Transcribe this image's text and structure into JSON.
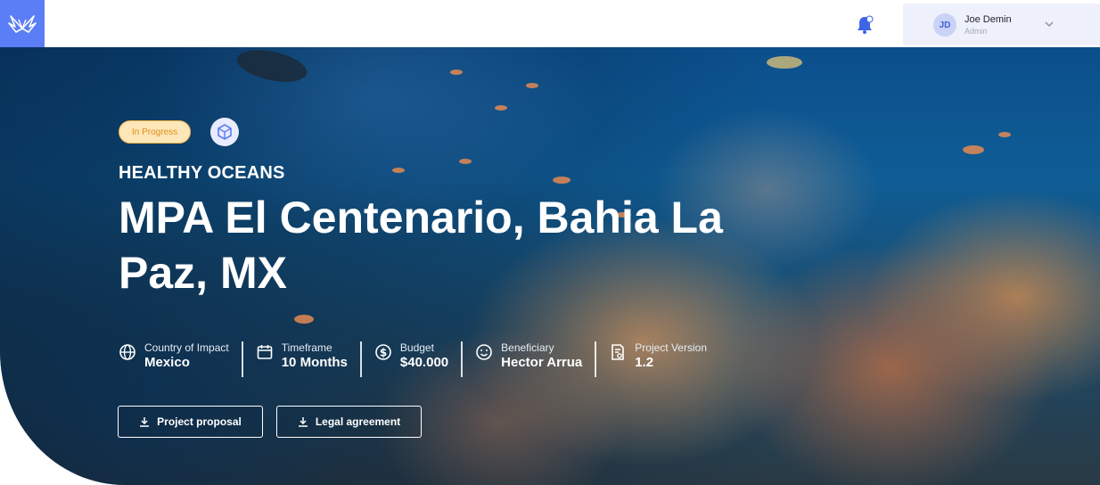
{
  "header": {
    "notification_count": "0",
    "user": {
      "initials": "JD",
      "name": "Joe Demin",
      "role": "Admin"
    }
  },
  "project": {
    "status": "In Progress",
    "category": "HEALTHY OCEANS",
    "title": "MPA El Centenario, Bahia La Paz, MX",
    "facts": [
      {
        "icon": "globe-icon",
        "label": "Country of Impact",
        "value": "Mexico"
      },
      {
        "icon": "calendar-icon",
        "label": "Timeframe",
        "value": "10 Months"
      },
      {
        "icon": "dollar-icon",
        "label": "Budget",
        "value": "$40.000"
      },
      {
        "icon": "smile-icon",
        "label": "Beneficiary",
        "value": "Hector Arrua"
      },
      {
        "icon": "document-icon",
        "label": "Project Version",
        "value": "1.2"
      }
    ],
    "buttons": {
      "proposal": "Project proposal",
      "legal": "Legal agreement"
    }
  },
  "colors": {
    "brand": "#5b7df5",
    "status_bg": "#fde6b8",
    "status_text": "#e08f1c"
  }
}
